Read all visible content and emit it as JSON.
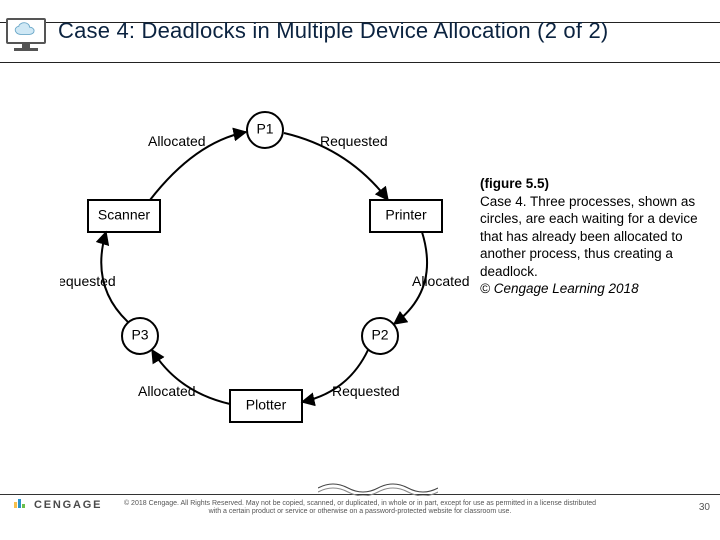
{
  "header": {
    "title": "Case 4: Deadlocks in Multiple Device Allocation (2 of 2)",
    "icon_name": "cloud-in-monitor-icon"
  },
  "diagram": {
    "processes": [
      "P1",
      "P2",
      "P3"
    ],
    "devices": [
      "Scanner",
      "Printer",
      "Plotter"
    ],
    "edges": {
      "scanner_to_p1": "Allocated",
      "p1_to_printer": "Requested",
      "printer_to_p2": "Allocated",
      "p2_to_plotter": "Requested",
      "plotter_to_p3": "Allocated",
      "p3_to_scanner": "Requested"
    }
  },
  "caption": {
    "fig_ref": "(figure 5.5)",
    "body": "Case 4. Three processes, shown as circles, are each waiting for a device that has already been allocated to another process, thus creating a deadlock.",
    "copyright": "© Cengage Learning 2018"
  },
  "footer": {
    "brand": "CENGAGE",
    "copy": "© 2018 Cengage. All Rights Reserved. May not be copied, scanned, or duplicated, in whole or in part, except for use as permitted in a license distributed with a certain product or service or otherwise on a password-protected website for classroom use.",
    "page_number": "30"
  }
}
